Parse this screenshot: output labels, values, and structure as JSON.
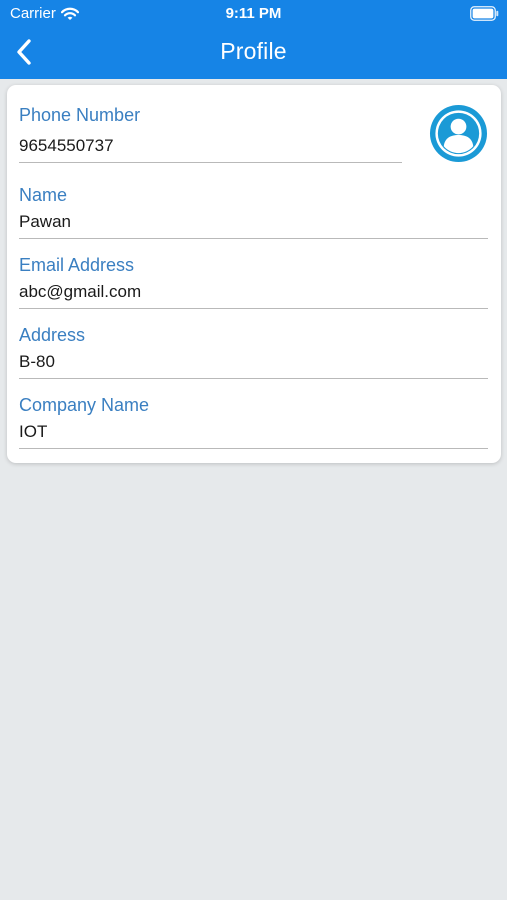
{
  "status_bar": {
    "carrier": "Carrier",
    "time": "9:11 PM",
    "wifi_icon": "wifi-icon",
    "battery_icon": "battery-icon"
  },
  "navbar": {
    "title": "Profile",
    "back_icon": "chevron-left-icon"
  },
  "profile": {
    "avatar_icon": "user-avatar-icon",
    "fields": [
      {
        "label": "Phone Number",
        "value": "9654550737"
      },
      {
        "label": "Name",
        "value": "Pawan"
      },
      {
        "label": "Email Address",
        "value": "abc@gmail.com"
      },
      {
        "label": "Address",
        "value": "B-80"
      },
      {
        "label": "Company Name",
        "value": "IOT"
      }
    ]
  },
  "colors": {
    "nav_background": "#1684e6",
    "label_color": "#3a7fc1",
    "avatar_color": "#1b9ad6",
    "page_background": "#e6e9eb"
  }
}
